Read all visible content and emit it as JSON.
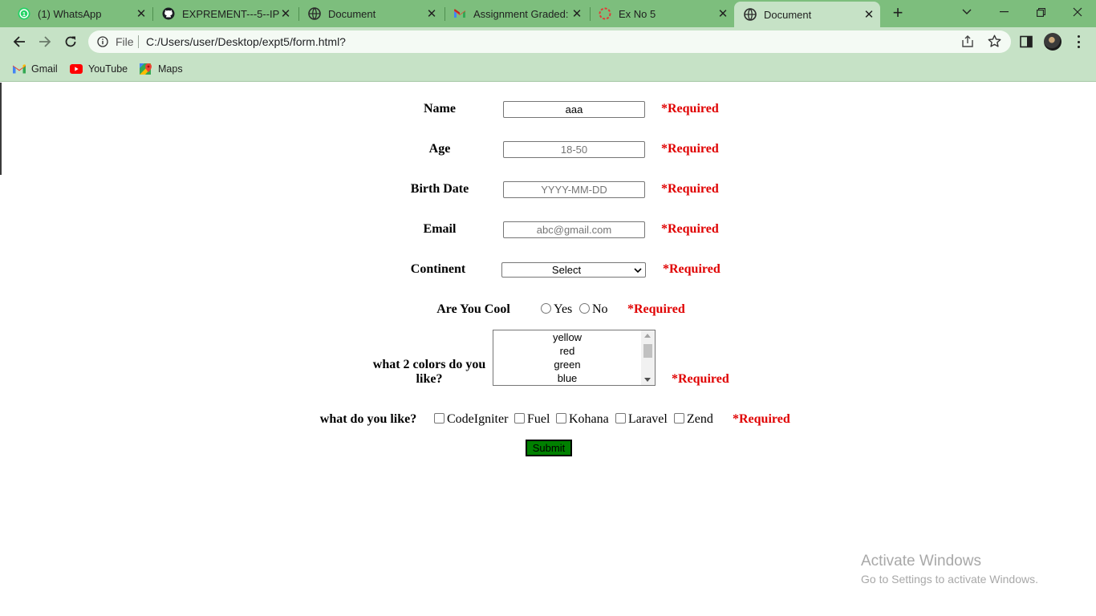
{
  "browser": {
    "tabs": [
      {
        "title": "(1) WhatsApp",
        "icon": "whatsapp-icon",
        "active": false
      },
      {
        "title": "EXPREMENT---5--IP/F",
        "icon": "github-icon",
        "active": false
      },
      {
        "title": "Document",
        "icon": "globe-icon",
        "active": false
      },
      {
        "title": "Assignment Graded: E",
        "icon": "gmail-icon",
        "active": false
      },
      {
        "title": "Ex No 5",
        "icon": "loading-icon",
        "active": false
      },
      {
        "title": "Document",
        "icon": "globe-icon",
        "active": true
      }
    ],
    "address": {
      "scheme_label": "File",
      "url": "C:/Users/user/Desktop/expt5/form.html?"
    },
    "bookmarks": [
      {
        "label": "Gmail",
        "icon": "gmail-icon"
      },
      {
        "label": "YouTube",
        "icon": "youtube-icon"
      },
      {
        "label": "Maps",
        "icon": "maps-icon"
      }
    ],
    "colors": {
      "frame": "#7dbe7d",
      "toolbar": "#c6e2c6"
    }
  },
  "form": {
    "required_text": "*Required",
    "name": {
      "label": "Name",
      "value": "aaa",
      "placeholder": ""
    },
    "age": {
      "label": "Age",
      "value": "",
      "placeholder": "18-50"
    },
    "birth_date": {
      "label": "Birth Date",
      "value": "",
      "placeholder": "YYYY-MM-DD"
    },
    "email": {
      "label": "Email",
      "value": "",
      "placeholder": "abc@gmail.com"
    },
    "continent": {
      "label": "Continent",
      "selected": "Select"
    },
    "cool": {
      "label": "Are You Cool",
      "options": [
        "Yes",
        "No"
      ]
    },
    "colors": {
      "label": "what 2 colors do you like?",
      "options": [
        "yellow",
        "red",
        "green",
        "blue"
      ]
    },
    "likes": {
      "label": "what do you like?",
      "options": [
        "CodeIgniter",
        "Fuel",
        "Kohana",
        "Laravel",
        "Zend"
      ]
    },
    "submit_label": "Submit",
    "colors_style": {
      "required": "#e00000",
      "submit_bg": "#008000"
    }
  },
  "watermark": {
    "line1": "Activate Windows",
    "line2": "Go to Settings to activate Windows."
  }
}
